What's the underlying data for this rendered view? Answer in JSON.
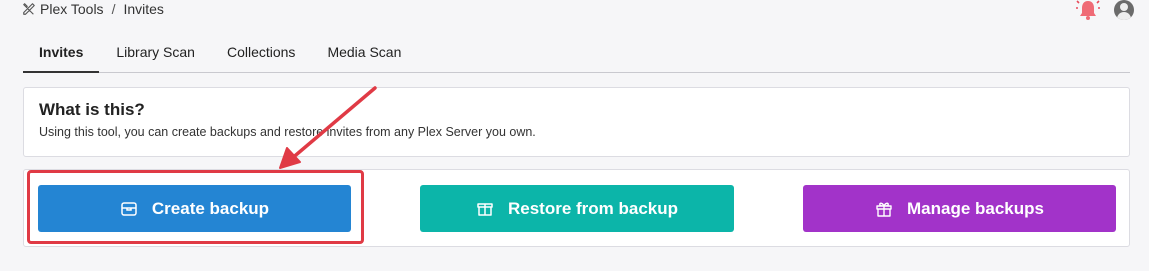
{
  "breadcrumb": {
    "root": "Plex Tools",
    "separator": "/",
    "current": "Invites"
  },
  "tabs": [
    {
      "label": "Invites",
      "active": true
    },
    {
      "label": "Library Scan",
      "active": false
    },
    {
      "label": "Collections",
      "active": false
    },
    {
      "label": "Media Scan",
      "active": false
    }
  ],
  "info": {
    "title": "What is this?",
    "description": "Using this tool, you can create backups and restore invites from any Plex Server you own."
  },
  "actions": {
    "create_label": "Create backup",
    "restore_label": "Restore from backup",
    "manage_label": "Manage backups"
  },
  "icons": {
    "breadcrumb": "tools-icon",
    "notifications": "bell-icon",
    "user": "avatar-icon",
    "create": "archive-box-icon",
    "restore": "open-box-icon",
    "manage": "gift-box-icon"
  },
  "colors": {
    "create": "#2485d3",
    "restore": "#0cb5a9",
    "manage": "#a233c9",
    "bell": "#e84a5a",
    "annotation": "#e03a45"
  }
}
